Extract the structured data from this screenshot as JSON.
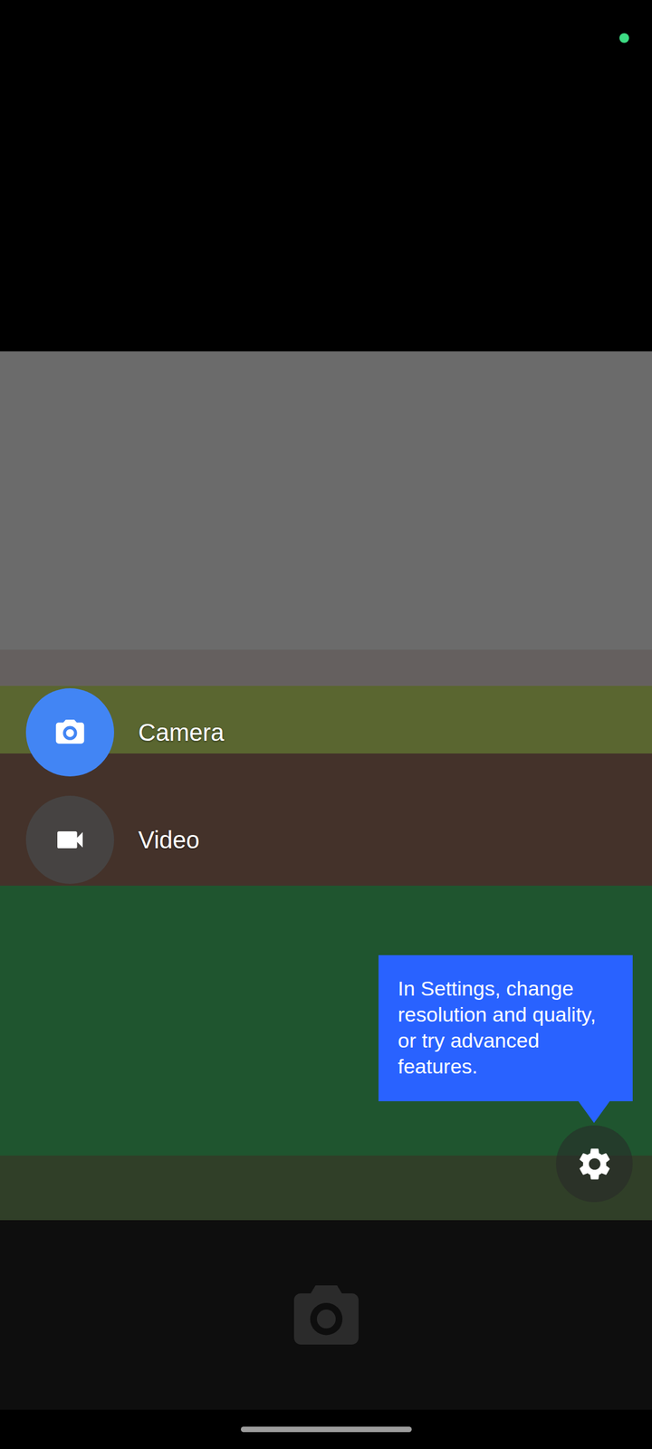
{
  "status_bar": {
    "privacy_indicator_on": true
  },
  "modes": [
    {
      "label": "Camera",
      "kind": "camera",
      "selected": true
    },
    {
      "label": "Video",
      "kind": "video",
      "selected": false
    }
  ],
  "tooltip": {
    "text": "In Settings, change resolution and quality, or try advanced features."
  },
  "shutter": {
    "disabled": true
  }
}
